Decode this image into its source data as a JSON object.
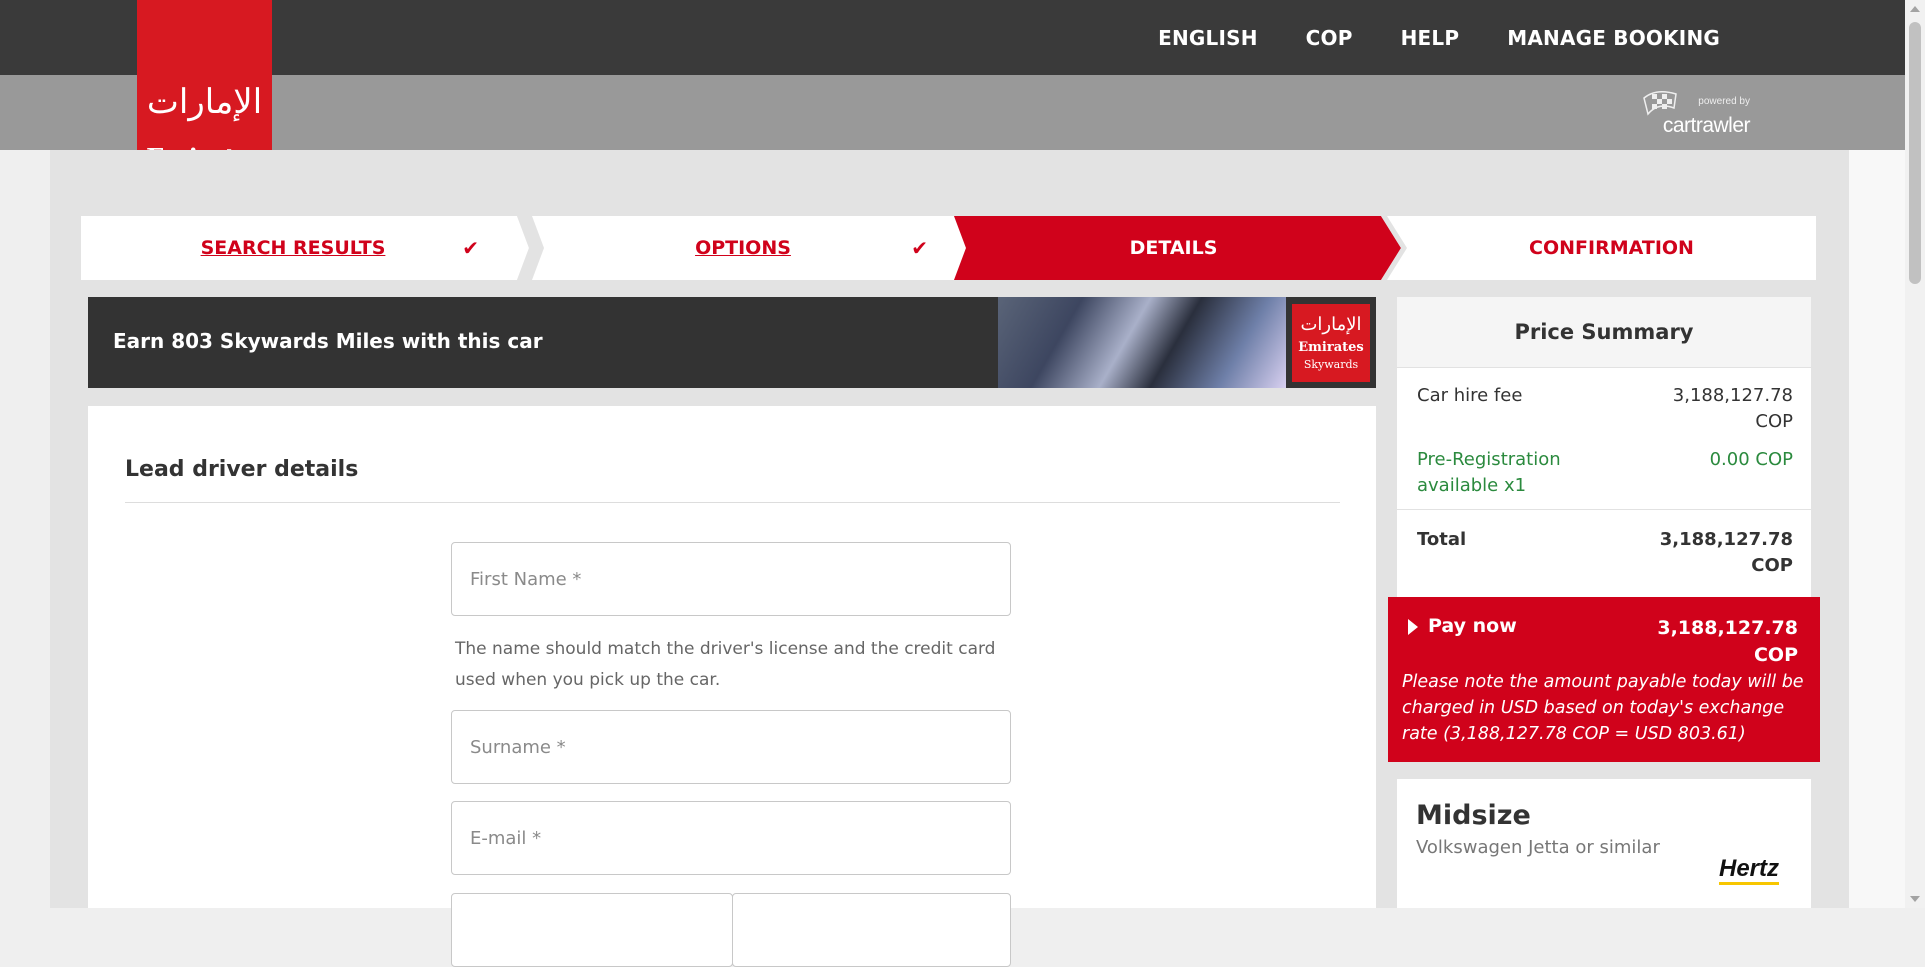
{
  "header": {
    "nav": [
      "ENGLISH",
      "COP",
      "HELP",
      "MANAGE BOOKING"
    ],
    "logo_text": "Emirates",
    "logo_arabic": "الإمارات",
    "powered_by": "powered by",
    "powered_brand": "cartrawler"
  },
  "steps": [
    {
      "label": "SEARCH RESULTS",
      "status": "done"
    },
    {
      "label": "OPTIONS",
      "status": "done"
    },
    {
      "label": "DETAILS",
      "status": "active"
    },
    {
      "label": "CONFIRMATION",
      "status": "upcoming"
    }
  ],
  "check_icon": "✔",
  "banner": {
    "text": "Earn 803 Skywards Miles with this car",
    "logo_line1": "Emirates",
    "logo_line2": "Skywards"
  },
  "form": {
    "title": "Lead driver details",
    "first_name_placeholder": "First Name *",
    "name_hint": "The name should match the driver's license and the credit card used when you pick up the car.",
    "surname_placeholder": "Surname *",
    "email_placeholder": "E-mail *"
  },
  "summary": {
    "title": "Price Summary",
    "car_hire_label": "Car hire fee",
    "car_hire_value": "3,188,127.78 COP",
    "prereg_label": "Pre-Registration available x1",
    "prereg_value": "0.00 COP",
    "total_label": "Total",
    "total_value": "3,188,127.78 COP",
    "pay_now_label": "Pay now",
    "pay_now_value": "3,188,127.78 COP",
    "pay_note": "Please note the amount payable today will be charged in USD based on today's exchange rate (3,188,127.78 COP = USD 803.61)"
  },
  "car": {
    "class": "Midsize",
    "model": "Volkswagen Jetta or similar",
    "supplier": "Hertz"
  },
  "colors": {
    "brand_red": "#d0021b",
    "topbar": "#3a3a3a",
    "green": "#2b8a3e"
  }
}
